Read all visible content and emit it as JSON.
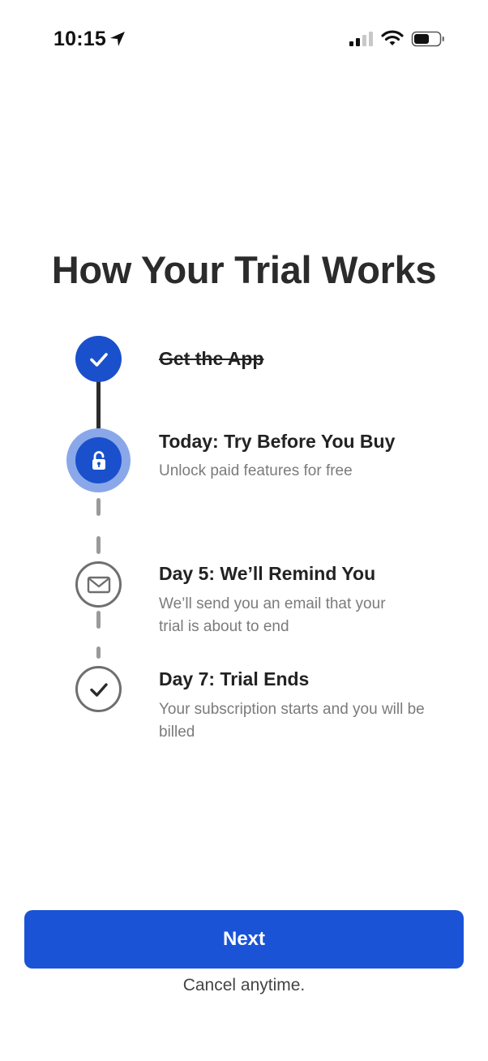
{
  "status_bar": {
    "time": "10:15",
    "icons": [
      "location-arrow-icon",
      "cellular-signal-icon",
      "wifi-icon",
      "battery-icon"
    ]
  },
  "title": "How Your Trial Works",
  "steps": [
    {
      "title": "Get the App",
      "description": "",
      "icon": "check-icon",
      "state": "completed"
    },
    {
      "title": "Today: Try Before You Buy",
      "description": "Unlock paid features for free",
      "icon": "unlock-icon",
      "state": "current"
    },
    {
      "title": "Day 5: We’ll Remind You",
      "description": "We’ll send you an email that your trial is about to end",
      "icon": "envelope-icon",
      "state": "upcoming"
    },
    {
      "title": "Day 7: Trial Ends",
      "description": "Your subscription starts and you will be billed",
      "icon": "check-icon",
      "state": "upcoming"
    }
  ],
  "next_button": "Next",
  "cancel_note": "Cancel anytime.",
  "colors": {
    "accent": "#1a53d6",
    "accent_halo": "#8aa8e9",
    "text_primary": "#222222",
    "text_secondary": "#7b7b7b",
    "line_dashed": "#9a9a9a"
  }
}
